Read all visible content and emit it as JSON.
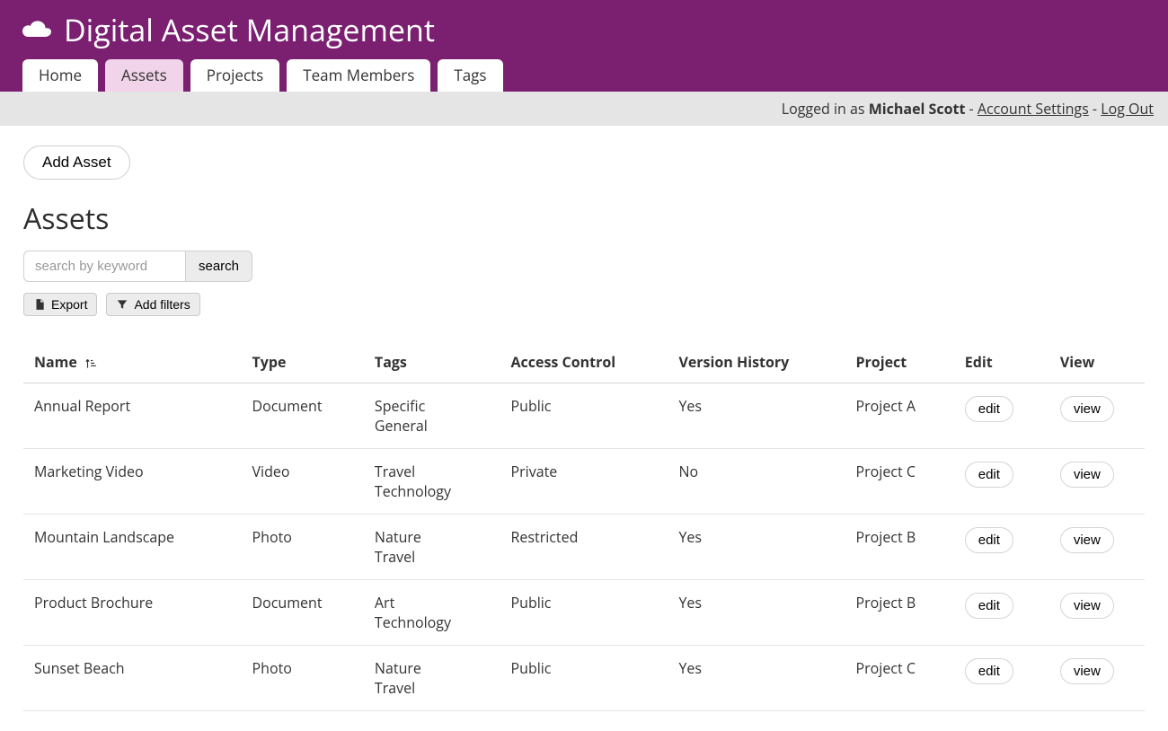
{
  "app": {
    "title": "Digital Asset Management"
  },
  "nav": {
    "items": [
      {
        "label": "Home",
        "active": false
      },
      {
        "label": "Assets",
        "active": true
      },
      {
        "label": "Projects",
        "active": false
      },
      {
        "label": "Team Members",
        "active": false
      },
      {
        "label": "Tags",
        "active": false
      }
    ]
  },
  "user_bar": {
    "logged_in_prefix": "Logged in as ",
    "username": "Michael Scott",
    "account_link": "Account Settings",
    "logout_link": "Log Out",
    "sep": " - "
  },
  "actions": {
    "add_asset": "Add Asset"
  },
  "page": {
    "title": "Assets"
  },
  "search": {
    "placeholder": "search by keyword",
    "button": "search"
  },
  "toolbar": {
    "export": "Export",
    "add_filters": "Add filters"
  },
  "table": {
    "headers": {
      "name": "Name",
      "type": "Type",
      "tags": "Tags",
      "access": "Access Control",
      "version": "Version History",
      "project": "Project",
      "edit": "Edit",
      "view": "View"
    },
    "row_buttons": {
      "edit": "edit",
      "view": "view"
    },
    "rows": [
      {
        "name": "Annual Report",
        "type": "Document",
        "tags": [
          "Specific",
          "General"
        ],
        "access": "Public",
        "version": "Yes",
        "project": "Project A"
      },
      {
        "name": "Marketing Video",
        "type": "Video",
        "tags": [
          "Travel",
          "Technology"
        ],
        "access": "Private",
        "version": "No",
        "project": "Project C"
      },
      {
        "name": "Mountain Landscape",
        "type": "Photo",
        "tags": [
          "Nature",
          "Travel"
        ],
        "access": "Restricted",
        "version": "Yes",
        "project": "Project B"
      },
      {
        "name": "Product Brochure",
        "type": "Document",
        "tags": [
          "Art",
          "Technology"
        ],
        "access": "Public",
        "version": "Yes",
        "project": "Project B"
      },
      {
        "name": "Sunset Beach",
        "type": "Photo",
        "tags": [
          "Nature",
          "Travel"
        ],
        "access": "Public",
        "version": "Yes",
        "project": "Project C"
      }
    ]
  }
}
